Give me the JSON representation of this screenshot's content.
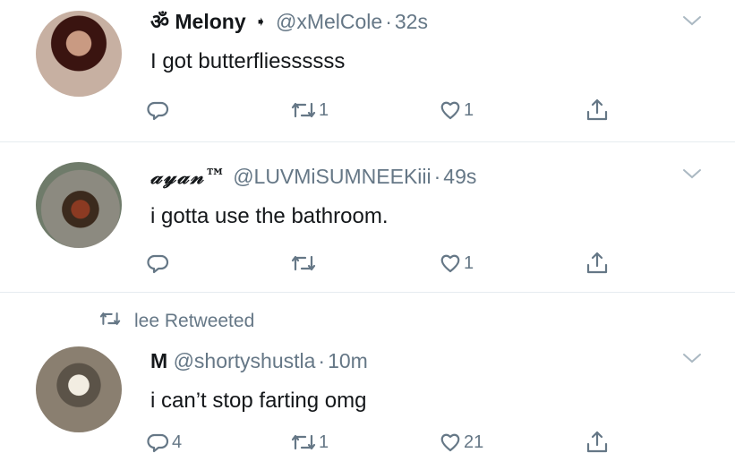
{
  "tweets": [
    {
      "display_name": "Melony",
      "name_prefix_symbol": "ॐ",
      "badge_icon": "arrow-badge-icon",
      "handle": "@xMelCole",
      "separator": "·",
      "time": "32s",
      "text": "I got butterfliessssss",
      "replies": "",
      "retweets": "1",
      "likes": "1"
    },
    {
      "display_name": "𝒶𝓎𝒶𝓃™",
      "handle": "@LUVMiSUMNEEKiii",
      "separator": "·",
      "time": "49s",
      "text": "i gotta use the bathroom.",
      "replies": "",
      "retweets": "",
      "likes": "1"
    },
    {
      "retweeted_by": "lee Retweeted",
      "display_name": "M",
      "handle": "@shortyshustla",
      "separator": "·",
      "time": "10m",
      "text": "i can’t stop farting omg",
      "replies": "4",
      "retweets": "1",
      "likes": "21"
    }
  ],
  "icons": {
    "reply": "reply-icon",
    "retweet": "retweet-icon",
    "like": "heart-icon",
    "share": "share-icon",
    "more": "chevron-down-icon"
  },
  "colors": {
    "text_primary": "#14171a",
    "text_secondary": "#657786",
    "divider": "#e6ecf0"
  }
}
